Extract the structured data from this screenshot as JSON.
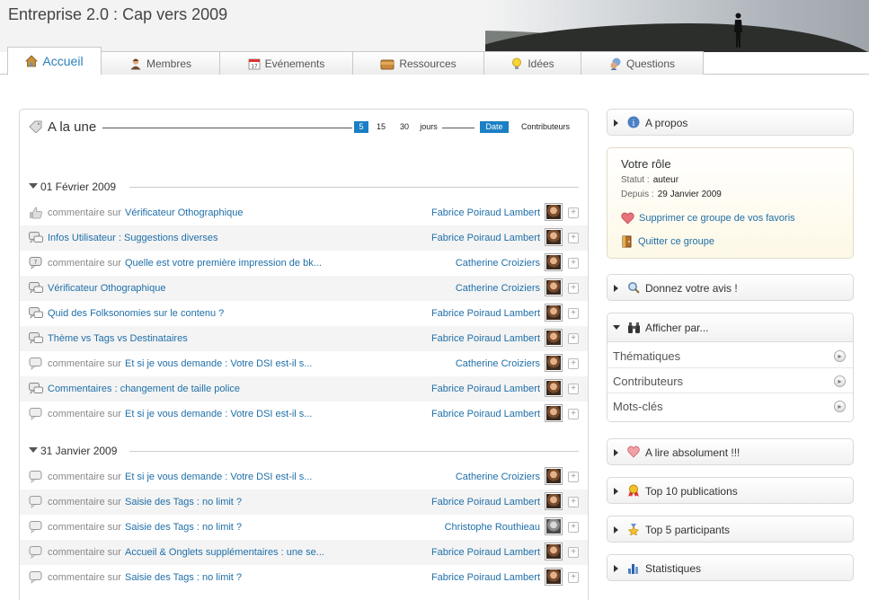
{
  "site": {
    "title": "Entreprise 2.0 : Cap vers 2009"
  },
  "tabs": [
    {
      "label": "Accueil",
      "icon": "home-icon",
      "active": true
    },
    {
      "label": "Membres",
      "icon": "member-icon"
    },
    {
      "label": "Evénements",
      "icon": "calendar-icon"
    },
    {
      "label": "Ressources",
      "icon": "folder-icon"
    },
    {
      "label": "Idées",
      "icon": "lightbulb-icon"
    },
    {
      "label": "Questions",
      "icon": "question-icon"
    }
  ],
  "alaune": {
    "title": "A la une",
    "periods": [
      "5",
      "15",
      "30"
    ],
    "period_selected": "5",
    "period_unit": "jours",
    "sort_date": "Date",
    "sort_contrib": "Contributeurs"
  },
  "feed": [
    {
      "date": "01 Février 2009",
      "items": [
        {
          "icon": "thumbs-up-icon",
          "prefix": "commentaire sur",
          "link": "Vérificateur Othographique",
          "author": "Fabrice Poiraud Lambert"
        },
        {
          "icon": "discussion-icon",
          "prefix": "",
          "link": "Infos Utilisateur : Suggestions diverses",
          "author": "Fabrice Poiraud Lambert"
        },
        {
          "icon": "question-bubble-icon",
          "prefix": "commentaire sur",
          "link": "Quelle est votre première impression de bk...",
          "author": "Catherine Croiziers"
        },
        {
          "icon": "discussion-icon",
          "prefix": "",
          "link": "Vérificateur Othographique",
          "author": "Catherine Croiziers"
        },
        {
          "icon": "discussion-icon",
          "prefix": "",
          "link": "Quid des Folksonomies sur le contenu ?",
          "author": "Fabrice Poiraud Lambert"
        },
        {
          "icon": "discussion-icon",
          "prefix": "",
          "link": "Thème vs Tags vs Destinataires",
          "author": "Fabrice Poiraud Lambert"
        },
        {
          "icon": "comment-icon",
          "prefix": "commentaire sur",
          "link": "Et si je vous demande : Votre DSI est-il s...",
          "author": "Catherine Croiziers"
        },
        {
          "icon": "discussion-icon",
          "prefix": "",
          "link": "Commentaires : changement de taille police",
          "author": "Fabrice Poiraud Lambert"
        },
        {
          "icon": "comment-icon",
          "prefix": "commentaire sur",
          "link": "Et si je vous demande : Votre DSI est-il s...",
          "author": "Fabrice Poiraud Lambert"
        }
      ]
    },
    {
      "date": "31 Janvier 2009",
      "items": [
        {
          "icon": "comment-icon",
          "prefix": "commentaire sur",
          "link": "Et si je vous demande : Votre DSI est-il s...",
          "author": "Catherine Croiziers"
        },
        {
          "icon": "comment-icon",
          "prefix": "commentaire sur",
          "link": "Saisie des Tags : no limit ?",
          "author": "Fabrice Poiraud Lambert"
        },
        {
          "icon": "comment-icon",
          "prefix": "commentaire sur",
          "link": "Saisie des Tags : no limit ?",
          "author": "Christophe Routhieau"
        },
        {
          "icon": "comment-icon",
          "prefix": "commentaire sur",
          "link": "Accueil & Onglets supplémentaires : une se...",
          "author": "Fabrice Poiraud Lambert"
        },
        {
          "icon": "comment-icon",
          "prefix": "commentaire sur",
          "link": "Saisie des Tags : no limit ?",
          "author": "Fabrice Poiraud Lambert"
        }
      ]
    }
  ],
  "sidebar": {
    "apropos": "A propos",
    "role": {
      "title": "Votre rôle",
      "statut_label": "Statut :",
      "statut_value": "auteur",
      "depuis_label": "Depuis :",
      "depuis_value": "29 Janvier 2009",
      "remove_fav": "Supprimer ce groupe de vos favoris",
      "quit": "Quitter ce groupe"
    },
    "avis": "Donnez votre avis !",
    "afficher": {
      "title": "Afficher par...",
      "items": [
        "Thématiques",
        "Contributeurs",
        "Mots-clés"
      ]
    },
    "alire": "A lire absolument !!!",
    "top10": "Top 10 publications",
    "top5": "Top 5 participants",
    "stats": "Statistiques"
  },
  "colors": {
    "link": "#1f6fa8",
    "accent": "#1a7fc4"
  }
}
